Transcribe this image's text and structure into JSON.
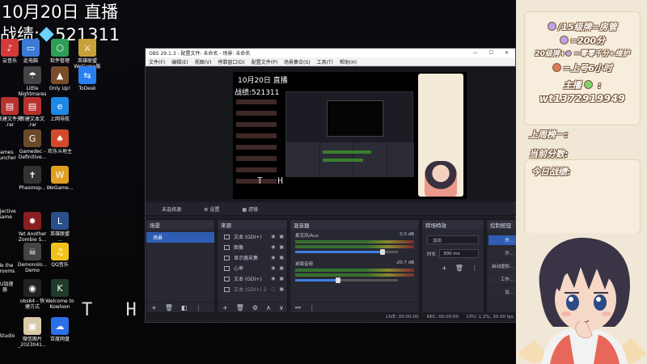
{
  "overlay": {
    "title": "10月20日 直播",
    "record_label": "战绩:",
    "record_value": "521311"
  },
  "desktop_icons": [
    {
      "label": "云音乐",
      "color": "#d33a3a",
      "glyph": "♪"
    },
    {
      "label": "此电脑",
      "color": "#3b7bd6",
      "glyph": "▭"
    },
    {
      "label": "软件管理",
      "color": "#2f9e55",
      "glyph": "⬡"
    },
    {
      "label": "英雄联盟\nWeGame版",
      "color": "#c7a23a",
      "glyph": "⚔"
    },
    {
      "label": "Little\nNightmares",
      "color": "#444",
      "glyph": "☂"
    },
    {
      "label": "Only Up!",
      "color": "#7a4c2a",
      "glyph": "▲"
    },
    {
      "label": "ToDesk",
      "color": "#2a7ff0",
      "glyph": "⇆"
    },
    {
      "label": "新建文件夹\n.rar",
      "color": "#b8312f",
      "glyph": "▤"
    },
    {
      "label": "新建文本文\n.rar",
      "color": "#b8312f",
      "glyph": "▤"
    },
    {
      "label": "上网导航",
      "color": "#1e88e5",
      "glyph": "e"
    },
    {
      "label": "Gamedec -\nDefinitive...",
      "color": "#6a4a2a",
      "glyph": "G"
    },
    {
      "label": "欢乐斗地主",
      "color": "#d24a2a",
      "glyph": "♠"
    },
    {
      "label": "Phasmop...",
      "color": "#333",
      "glyph": "✝"
    },
    {
      "label": "WeGame...",
      "color": "#e0a020",
      "glyph": "W"
    },
    {
      "label": "Yet Another\nZombie S...",
      "color": "#8a1f1f",
      "glyph": "✸"
    },
    {
      "label": "英雄联盟\n...",
      "color": "#2a4f8a",
      "glyph": "L"
    },
    {
      "label": "Demonolo...\nDemo",
      "color": "#444",
      "glyph": "☠"
    },
    {
      "label": "QQ音乐",
      "color": "#f1c21b",
      "glyph": "♫"
    },
    {
      "label": "obs64 - 快\n捷方式",
      "color": "#222",
      "glyph": "◉"
    },
    {
      "label": "Welcome to\nKowloon",
      "color": "#1f3b2a",
      "glyph": "K"
    },
    {
      "label": "微信图片\n_2023041...",
      "color": "#d9c9a8",
      "glyph": "▣"
    },
    {
      "label": "百度网盘",
      "color": "#2b6fe8",
      "glyph": "☁"
    }
  ],
  "desktop_left_labels": [
    "Games\nLauncher",
    "UU加速\n器",
    "ide the\nrkrooms",
    "objective\nGame",
    "S Studio"
  ],
  "big_letters": "T H",
  "obs": {
    "title": "OBS 29.1.3 - 配置文件: 未命名 - 场景: 未命名",
    "window_controls": [
      "—",
      "☐",
      "✕"
    ],
    "menu": [
      "文件(F)",
      "编辑(E)",
      "视图(V)",
      "停靠窗口(D)",
      "配置文件(P)",
      "场景集合(S)",
      "工具(T)",
      "帮助(H)"
    ],
    "scene_bar": {
      "label": "未选择源",
      "properties": "设置",
      "filters": "滤镜"
    },
    "scenes_dock": {
      "title": "场景",
      "items": [
        "场景"
      ]
    },
    "sources_dock": {
      "title": "来源",
      "items": [
        "文本 (GDI+)",
        "图像",
        "显示器采集",
        "心率",
        "文本 (GDI+)",
        "文本 (GDI+) 2"
      ]
    },
    "mixer_dock": {
      "title": "混音器",
      "channels": [
        {
          "name": "麦克风/Aux",
          "db": "0.0 dB",
          "level": 0.85
        },
        {
          "name": "桌面音频",
          "db": "-20.7 dB",
          "level": 0.42
        }
      ]
    },
    "transitions_dock": {
      "title": "转场特效",
      "effect": "淡出",
      "duration_label": "时长",
      "duration_value": "300 ms"
    },
    "controls_dock": {
      "title": "控制按钮",
      "buttons": [
        "开...",
        "开...",
        "启动虚拟...",
        "工作...",
        "设..."
      ]
    },
    "status": {
      "live": "LIVE: 00:00:00",
      "rec": "REC: 00:00:00",
      "cpu": "CPU: 1.2%, 30.00 fps"
    },
    "preview_title": "10月20日 直播",
    "preview_record": "战绩:521311"
  },
  "right_panel": {
    "rules": [
      "/15级牌=房管",
      "=200分",
      "20级牌+",
      "=上号6小时"
    ],
    "rule_extra": "=零零千分+维护",
    "host_label": "主播",
    "host_id": "wt1372919949",
    "last_week": "上周榜一:",
    "current_score": "当前分数:",
    "today_record": "今日战绩:"
  },
  "colors": {
    "obs_bg": "#1e1f26",
    "panel_cream": "#f7eddd",
    "accent_blue": "#3c7fe0"
  }
}
